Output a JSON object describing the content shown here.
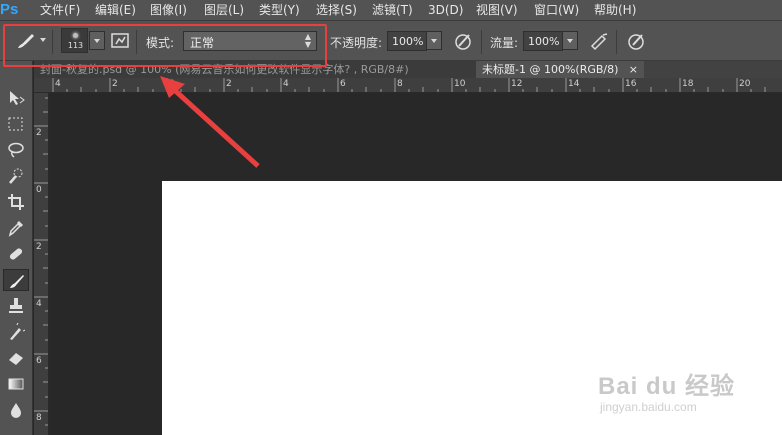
{
  "app": {
    "logo": "Ps"
  },
  "menu": [
    "文件(F)",
    "编辑(E)",
    "图像(I)",
    "图层(L)",
    "类型(Y)",
    "选择(S)",
    "滤镜(T)",
    "3D(D)",
    "视图(V)",
    "窗口(W)",
    "帮助(H)"
  ],
  "options": {
    "brush_size": "113",
    "mode_label": "模式:",
    "mode_value": "正常",
    "opacity_label": "不透明度:",
    "opacity_value": "100%",
    "flow_label": "流量:",
    "flow_value": "100%"
  },
  "tabs": [
    {
      "label": "封面-秋复的.psd @ 100% (网易云音乐如何更改软件显示字体? , RGB/8#)",
      "close": "×",
      "active": false
    },
    {
      "label": "未标题-1 @ 100%(RGB/8)",
      "close": "×",
      "active": true
    }
  ],
  "ruler_h_labels": [
    "4",
    "2",
    "0",
    "2",
    "4",
    "6",
    "8",
    "10",
    "12",
    "14",
    "16",
    "18",
    "20"
  ],
  "ruler_v_labels": [
    "2",
    "0",
    "2",
    "4",
    "6",
    "8"
  ],
  "tools": [
    "move-tool",
    "marquee-tool",
    "lasso-tool",
    "quick-selection-tool",
    "crop-tool",
    "eyedropper-tool",
    "healing-brush-tool",
    "brush-tool",
    "clone-stamp-tool",
    "history-brush-tool",
    "eraser-tool",
    "gradient-tool",
    "blur-tool"
  ],
  "watermark": {
    "main": "Bai du 经验",
    "sub": "jingyan.baidu.com"
  },
  "colors": {
    "highlight": "#e8403e",
    "canvas": "#ffffff",
    "workspace": "#282828",
    "panel": "#535353"
  }
}
